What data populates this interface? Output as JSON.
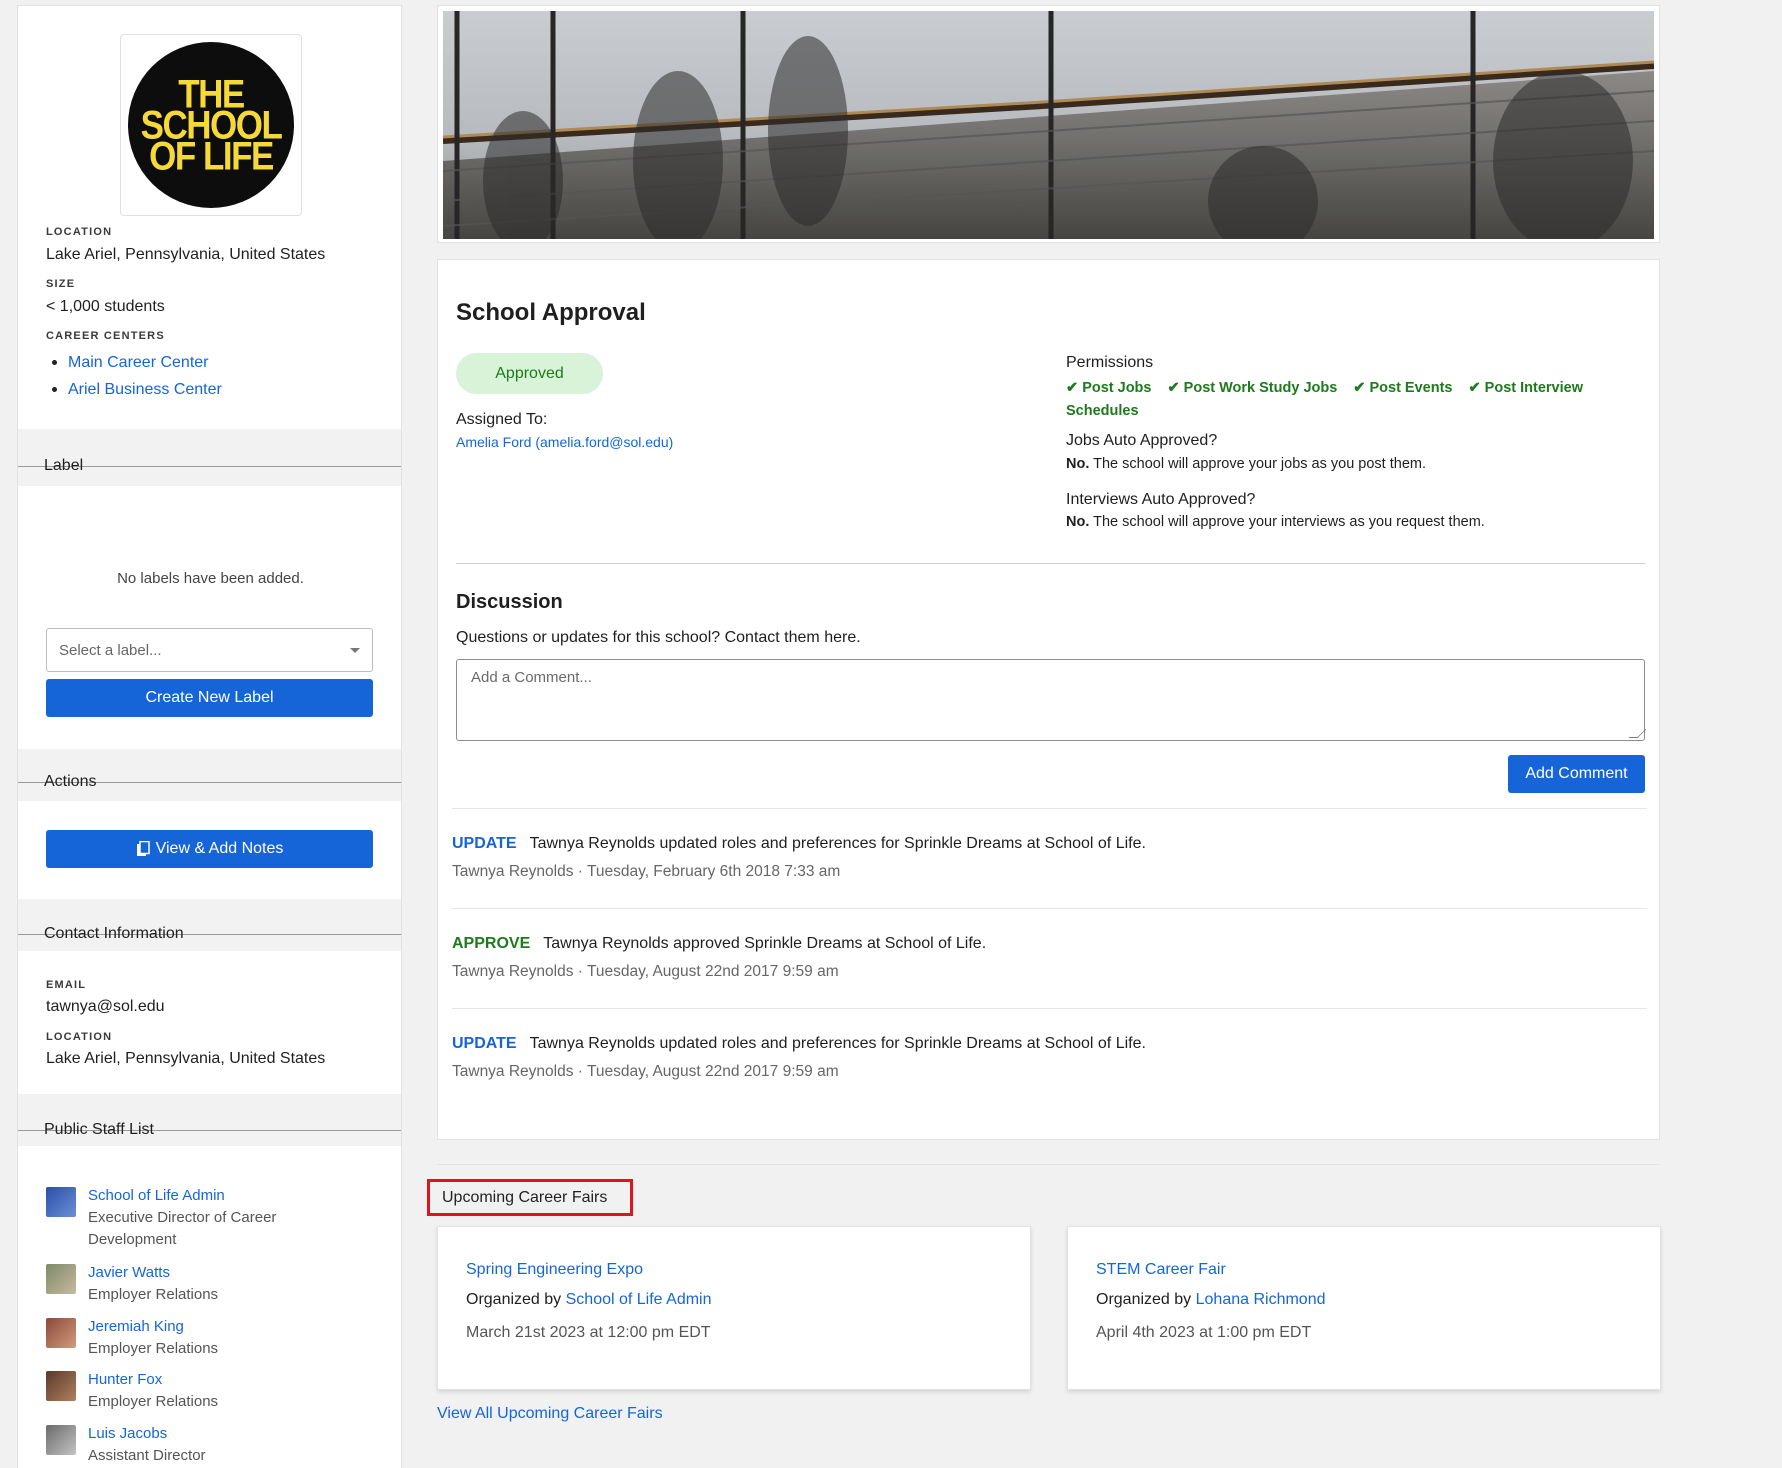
{
  "school": {
    "logo_lines": [
      "THE",
      "SCHOOL",
      "OF LIFE"
    ],
    "location_label": "LOCATION",
    "location": "Lake Ariel, Pennsylvania, United States",
    "size_label": "SIZE",
    "size": "< 1,000 students",
    "career_centers_label": "CAREER CENTERS",
    "career_centers": [
      "Main Career Center",
      "Ariel Business Center"
    ]
  },
  "labels": {
    "heading": "Label",
    "empty_text": "No labels have been added.",
    "select_placeholder": "Select a label...",
    "create_button": "Create New Label"
  },
  "actions": {
    "heading": "Actions",
    "notes_button": "View & Add Notes"
  },
  "contact": {
    "heading": "Contact Information",
    "email_label": "EMAIL",
    "email": "tawnya@sol.edu",
    "location_label": "LOCATION",
    "location": "Lake Ariel, Pennsylvania, United States"
  },
  "staff": {
    "heading": "Public Staff List",
    "members": [
      {
        "name": "School of Life Admin",
        "role": "Executive Director of Career Development"
      },
      {
        "name": "Javier Watts",
        "role": "Employer Relations"
      },
      {
        "name": "Jeremiah King",
        "role": "Employer Relations"
      },
      {
        "name": "Hunter Fox",
        "role": "Employer Relations"
      },
      {
        "name": "Luis Jacobs",
        "role": "Assistant Director"
      }
    ]
  },
  "approval": {
    "title": "School Approval",
    "status": "Approved",
    "assigned_label": "Assigned To:",
    "assigned_to": "Amelia Ford (amelia.ford@sol.edu)",
    "permissions_label": "Permissions",
    "permissions": [
      "Post Jobs",
      "Post Work Study Jobs",
      "Post Events",
      "Post Interview Schedules"
    ],
    "jobs_auto_label": "Jobs Auto Approved?",
    "jobs_auto_answer": "No.",
    "jobs_auto_text": "The school will approve your jobs as you post them.",
    "interviews_auto_label": "Interviews Auto Approved?",
    "interviews_auto_answer": "No.",
    "interviews_auto_text": "The school will approve your interviews as you request them."
  },
  "discussion": {
    "title": "Discussion",
    "subtitle": "Questions or updates for this school? Contact them here.",
    "placeholder": "Add a Comment...",
    "add_button": "Add Comment",
    "feed": [
      {
        "tag": "UPDATE",
        "text": "Tawnya Reynolds updated roles and preferences for Sprinkle Dreams at School of Life.",
        "meta": "Tawnya Reynolds · Tuesday, February 6th 2018 7:33 am"
      },
      {
        "tag": "APPROVE",
        "text": "Tawnya Reynolds approved Sprinkle Dreams at School of Life.",
        "meta": "Tawnya Reynolds · Tuesday, August 22nd 2017 9:59 am"
      },
      {
        "tag": "UPDATE",
        "text": "Tawnya Reynolds updated roles and preferences for Sprinkle Dreams at School of Life.",
        "meta": "Tawnya Reynolds · Tuesday, August 22nd 2017 9:59 am"
      }
    ]
  },
  "fairs": {
    "heading": "Upcoming Career Fairs",
    "organized_by": "Organized by",
    "items": [
      {
        "name": "Spring Engineering Expo",
        "organizer": "School of Life Admin",
        "date": "March 21st 2023 at 12:00 pm EDT"
      },
      {
        "name": "STEM Career Fair",
        "organizer": "Lohana Richmond",
        "date": "April 4th 2023 at 1:00 pm EDT"
      }
    ],
    "view_all": "View All Upcoming Career Fairs"
  },
  "colors": {
    "link": "#1565d8",
    "primary_button": "#1565d8",
    "approved_bg": "#d8f3d8",
    "approved_text": "#1d7a1d",
    "highlight_border": "#e0141c",
    "logo_yellow": "#f5d938"
  }
}
